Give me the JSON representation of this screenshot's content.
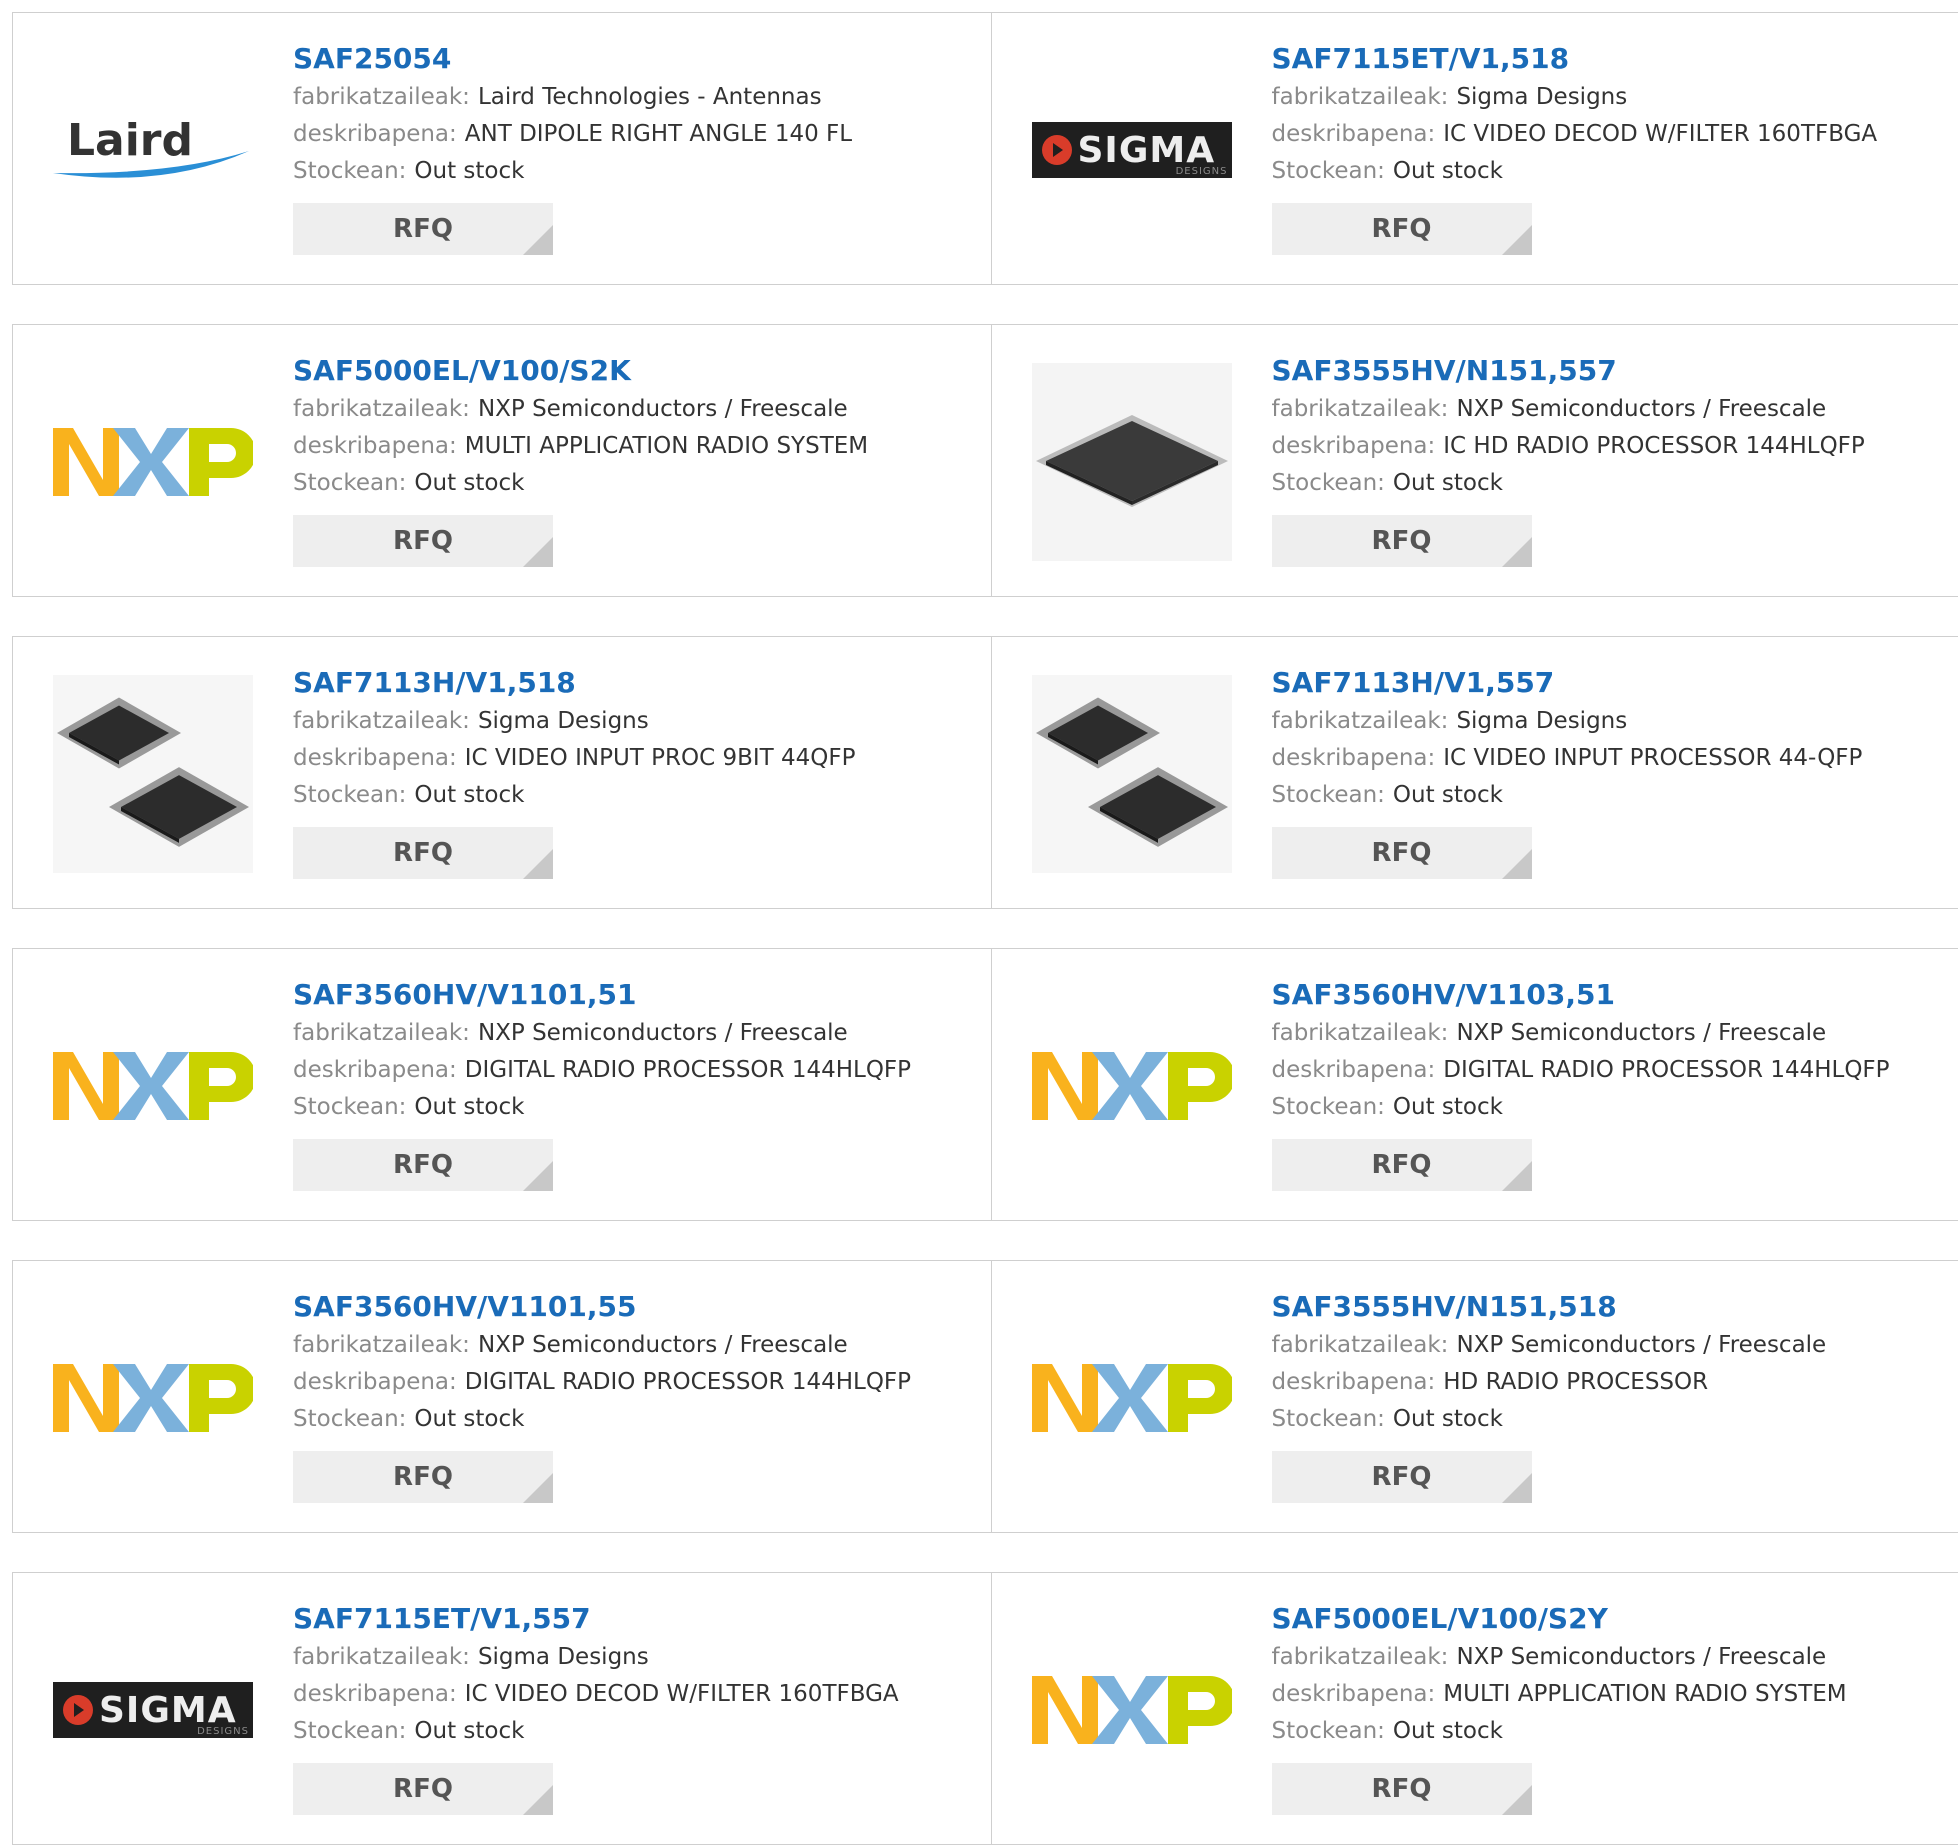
{
  "labels": {
    "manufacturer": "fabrikatzaileak:",
    "description": "deskribapena:",
    "stock": "Stockean:",
    "rfq": "RFQ"
  },
  "products": [
    {
      "part": "SAF25054",
      "manufacturer": "Laird Technologies - Antennas",
      "description": "ANT DIPOLE RIGHT ANGLE 140 FL",
      "stock": "Out stock",
      "logo": "laird",
      "logo_text": "Laird"
    },
    {
      "part": "SAF7115ET/V1,518",
      "manufacturer": "Sigma Designs",
      "description": "IC VIDEO DECOD W/FILTER 160TFBGA",
      "stock": "Out stock",
      "logo": "sigma",
      "logo_text": "SIGMA",
      "logo_sub": "DESIGNS"
    },
    {
      "part": "SAF5000EL/V100/S2K",
      "manufacturer": "NXP Semiconductors / Freescale",
      "description": "MULTI APPLICATION RADIO SYSTEM",
      "stock": "Out stock",
      "logo": "nxp"
    },
    {
      "part": "SAF3555HV/N151,557",
      "manufacturer": "NXP Semiconductors / Freescale",
      "description": "IC HD RADIO PROCESSOR 144HLQFP",
      "stock": "Out stock",
      "logo": "chip-flat"
    },
    {
      "part": "SAF7113H/V1,518",
      "manufacturer": "Sigma Designs",
      "description": "IC VIDEO INPUT PROC 9BIT 44QFP",
      "stock": "Out stock",
      "logo": "chip-qfp"
    },
    {
      "part": "SAF7113H/V1,557",
      "manufacturer": "Sigma Designs",
      "description": "IC VIDEO INPUT PROCESSOR 44-QFP",
      "stock": "Out stock",
      "logo": "chip-qfp"
    },
    {
      "part": "SAF3560HV/V1101,51",
      "manufacturer": "NXP Semiconductors / Freescale",
      "description": "DIGITAL RADIO PROCESSOR 144HLQFP",
      "stock": "Out stock",
      "logo": "nxp"
    },
    {
      "part": "SAF3560HV/V1103,51",
      "manufacturer": "NXP Semiconductors / Freescale",
      "description": "DIGITAL RADIO PROCESSOR 144HLQFP",
      "stock": "Out stock",
      "logo": "nxp"
    },
    {
      "part": "SAF3560HV/V1101,55",
      "manufacturer": "NXP Semiconductors / Freescale",
      "description": "DIGITAL RADIO PROCESSOR 144HLQFP",
      "stock": "Out stock",
      "logo": "nxp"
    },
    {
      "part": "SAF3555HV/N151,518",
      "manufacturer": "NXP Semiconductors / Freescale",
      "description": "HD RADIO PROCESSOR",
      "stock": "Out stock",
      "logo": "nxp"
    },
    {
      "part": "SAF7115ET/V1,557",
      "manufacturer": "Sigma Designs",
      "description": "IC VIDEO DECOD W/FILTER 160TFBGA",
      "stock": "Out stock",
      "logo": "sigma",
      "logo_text": "SIGMA",
      "logo_sub": "DESIGNS"
    },
    {
      "part": "SAF5000EL/V100/S2Y",
      "manufacturer": "NXP Semiconductors / Freescale",
      "description": "MULTI APPLICATION RADIO SYSTEM",
      "stock": "Out stock",
      "logo": "nxp"
    }
  ],
  "colors": {
    "part_link": "#1a6bb8",
    "nxp_orange": "#f9b21d",
    "nxp_blue": "#7bb1db",
    "nxp_green": "#c9d200",
    "sigma_red": "#d93c2a"
  }
}
